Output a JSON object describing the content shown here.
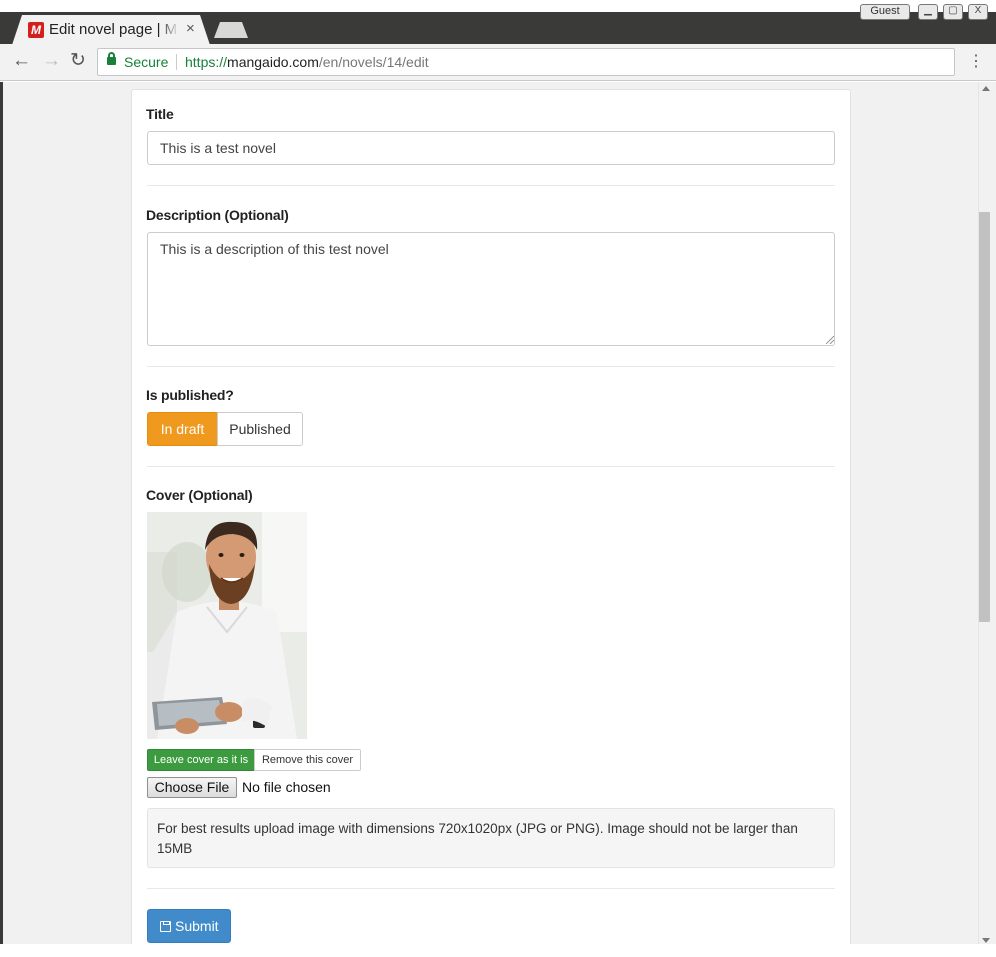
{
  "browser": {
    "tab_title": "Edit novel page | Mangaido",
    "tab_close": "×",
    "favicon_letter": "M",
    "profile_label": "Guest",
    "window_buttons": {
      "minimize": "▁",
      "maximize": "▢",
      "close": "X"
    },
    "nav": {
      "back": "←",
      "forward": "→",
      "reload": "↻",
      "menu": "⋮"
    },
    "secure_label": "Secure",
    "url_scheme": "https://",
    "url_host": "mangaido.com",
    "url_path": "/en/novels/14/edit"
  },
  "form": {
    "title_label": "Title",
    "title_value": "This is a test novel",
    "description_label": "Description (Optional)",
    "description_value": "This is a description of this test novel",
    "published_label": "Is published?",
    "published_options": [
      "In draft",
      "Published"
    ],
    "published_selected": "In draft",
    "cover_label": "Cover (Optional)",
    "cover_options": [
      "Leave cover as it is",
      "Remove this cover"
    ],
    "cover_selected": "Leave cover as it is",
    "file_button": "Choose File",
    "file_status": "No file chosen",
    "help_text": "For best results upload image with dimensions 720x1020px (JPG or PNG). Image should not be larger than 15MB",
    "submit_label": "Submit"
  },
  "colors": {
    "draft_active": "#ef991f",
    "cover_active": "#3c9a3f",
    "submit": "#428bca",
    "secure": "#188038"
  }
}
